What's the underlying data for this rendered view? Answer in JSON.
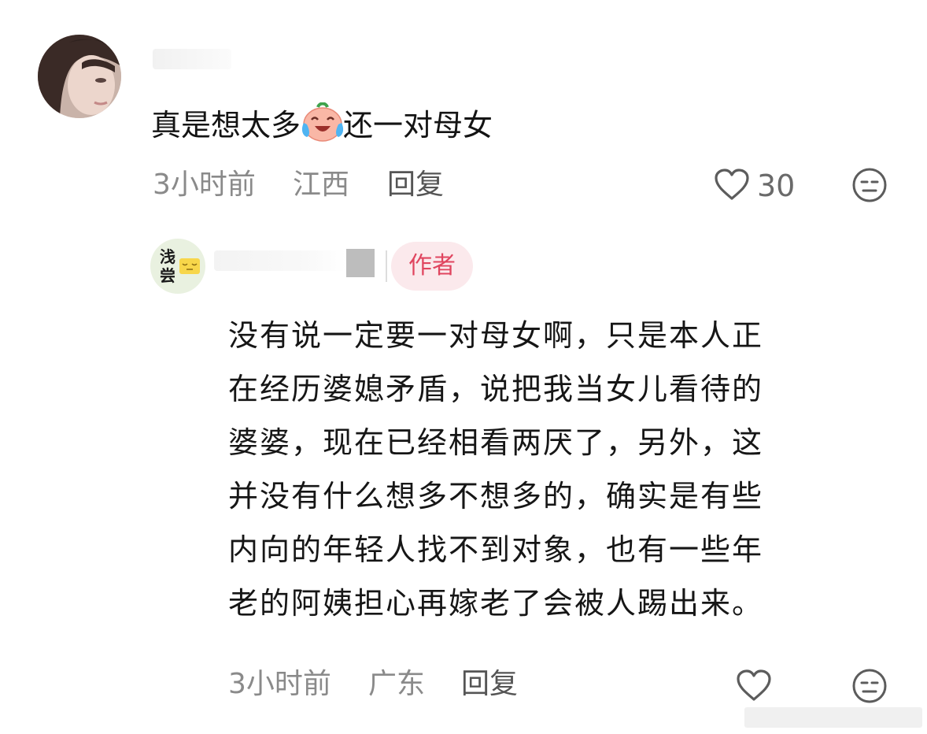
{
  "comment": {
    "text_before": "真是想太多",
    "emoji": "crying-laughing-face-emoji",
    "text_after": "还一对母女",
    "time": "3小时前",
    "location": "江西",
    "reply_label": "回复",
    "like_count": "30"
  },
  "reply": {
    "avatar_chars": [
      "浅",
      "尝"
    ],
    "author_badge": "作者",
    "lines": [
      "没有说一定要一对母女啊，只是本人正",
      "在经历婆媳矛盾，说把我当女儿看待的",
      "婆婆，现在已经相看两厌了，另外，这",
      "并没有什么想多不想多的，确实是有些",
      "内向的年轻人找不到对象，也有一些年",
      "老的阿姨担心再嫁老了会被人踢出来。"
    ],
    "time": "3小时前",
    "location": "广东",
    "reply_label": "回复"
  },
  "colors": {
    "meta_gray": "#8a8a8a",
    "author_pink": "#e0455f",
    "author_bg": "#fbe9ec"
  },
  "icons": [
    "heart-outline-icon",
    "face-unamused-icon"
  ]
}
